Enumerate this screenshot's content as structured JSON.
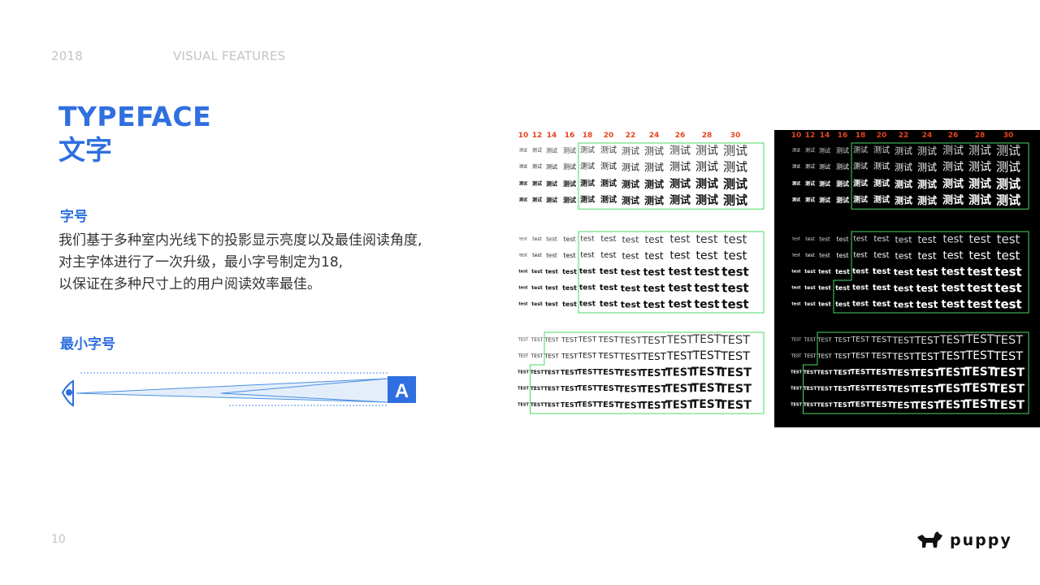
{
  "header": {
    "year": "2018",
    "section": "VISUAL FEATURES"
  },
  "title": {
    "en": "TYPEFACE",
    "zh": "文字"
  },
  "subheadings": {
    "font_size": "字号",
    "min_font_size": "最小字号"
  },
  "description": [
    "我们基于多种室内光线下的投影显示亮度以及最佳阅读角度,",
    "对主字体进行了一次升级，最小字号制定为18,",
    "以保证在多种尺寸上的用户阅读效率最佳。"
  ],
  "diagram": {
    "letter": "A",
    "icon": "eye-icon"
  },
  "page_number": "10",
  "logo": {
    "text": "puppy",
    "icon": "dog-icon"
  },
  "specimen": {
    "sizes": [
      "10",
      "12",
      "14",
      "16",
      "18",
      "20",
      "22",
      "24",
      "26",
      "28",
      "30"
    ],
    "groups": [
      {
        "word": "测试",
        "weights": [
          300,
          400,
          500,
          600
        ]
      },
      {
        "word": "test",
        "weights": [
          300,
          400,
          500,
          600,
          700
        ]
      },
      {
        "word": "TEST",
        "weights": [
          300,
          400,
          500,
          600,
          700
        ]
      }
    ]
  },
  "colors": {
    "accent": "#2f6fe0",
    "size_label": "#e8431f",
    "outline": "#4cd964",
    "dark_bg": "#000000"
  }
}
